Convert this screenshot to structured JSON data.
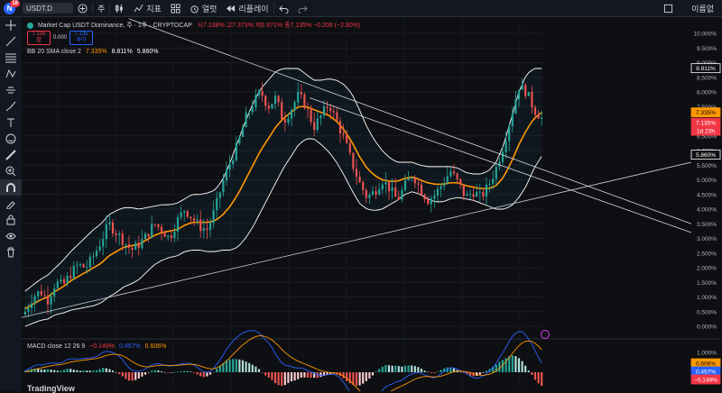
{
  "topbar": {
    "avatar_letter": "N",
    "avatar_badge": "18",
    "symbol": "USDT.D",
    "interval": "주",
    "indicators_label": "지표",
    "alert_label": "얼럿",
    "replay_label": "리플레이",
    "window_label": "이름없"
  },
  "header": {
    "title": "Market Cap USDT Dominance, 주 · 1주 · CRYPTOCAP",
    "ohlc_line": "시7.138% 고7.373% 저6.971% 종7.135% −0.206 (−2.80%)",
    "sell_price": "7.135",
    "sell_label": "팔",
    "spread": "0.000",
    "buy_price": "7.135",
    "buy_label": "바이",
    "bb_label": "BB 20 SMA close 2",
    "bb_basis": "7.335%",
    "bb_upper": "8.811%",
    "bb_lower": "5.860%"
  },
  "macd": {
    "label": "MACD close 12 26 9",
    "macd": "−0.149%",
    "signal": "0.457%",
    "hist": "0.606%"
  },
  "price_axis": {
    "ticks": [
      "10.000%",
      "9.500%",
      "9.000%",
      "8.500%",
      "8.000%",
      "7.500%",
      "6.500%",
      "6.000%",
      "5.500%",
      "5.000%",
      "4.500%",
      "4.000%",
      "3.500%",
      "3.000%",
      "2.500%",
      "2.000%",
      "1.500%",
      "1.000%",
      "0.500%",
      "0.000%"
    ],
    "tag_upper": "8.811%",
    "tag_basis": "7.335%",
    "tag_close": "7.135%",
    "tag_countdown": "1d 23h",
    "tag_lower": "5.860%"
  },
  "macd_axis": {
    "ticks": [
      "1.000%",
      "0.500%",
      "−0.500%"
    ],
    "tag_hist": "0.606%",
    "tag_signal": "0.457%",
    "tag_macd": "−0.149%"
  },
  "watermark": "TradingView",
  "colors": {
    "up": "#26a69a",
    "down": "#ef5350",
    "basis": "#ff9800",
    "band": "#ffffff",
    "signal": "#2962ff"
  },
  "chart_data": {
    "type": "candlestick",
    "title": "Market Cap USDT Dominance",
    "interval": "1W",
    "ylim": [
      0,
      10
    ],
    "close_path": [
      0.5,
      1.0,
      1.2,
      0.9,
      1.5,
      1.4,
      1.8,
      2.1,
      2.0,
      2.4,
      2.9,
      3.5,
      3.2,
      2.9,
      2.6,
      2.8,
      3.1,
      3.5,
      3.3,
      3.0,
      3.6,
      4.0,
      3.7,
      3.4,
      3.3,
      4.0,
      4.9,
      5.6,
      6.2,
      7.1,
      7.6,
      8.0,
      7.5,
      7.8,
      7.0,
      7.4,
      7.9,
      7.5,
      6.8,
      7.2,
      7.6,
      7.0,
      6.4,
      5.6,
      4.9,
      4.4,
      4.6,
      5.0,
      4.7,
      4.3,
      4.8,
      5.2,
      4.7,
      4.3,
      4.5,
      4.9,
      5.3,
      4.9,
      4.4,
      4.6,
      4.4,
      4.8,
      5.4,
      6.2,
      7.2,
      8.2,
      8.0,
      7.4,
      7.1
    ],
    "bb_basis_path": [
      0.6,
      0.75,
      0.9,
      1.0,
      1.2,
      1.35,
      1.55,
      1.7,
      1.85,
      2.0,
      2.15,
      2.4,
      2.55,
      2.7,
      2.75,
      2.8,
      2.95,
      3.1,
      3.2,
      3.25,
      3.3,
      3.45,
      3.55,
      3.55,
      3.55,
      3.6,
      3.8,
      4.1,
      4.5,
      5.0,
      5.5,
      6.0,
      6.4,
      6.8,
      7.1,
      7.3,
      7.5,
      7.5,
      7.4,
      7.3,
      7.2,
      7.0,
      6.7,
      6.3,
      5.8,
      5.4,
      5.15,
      5.0,
      4.95,
      4.95,
      5.05,
      5.1,
      5.0,
      4.9,
      4.85,
      4.85,
      4.9,
      4.9,
      4.8,
      4.75,
      4.7,
      4.7,
      4.8,
      5.1,
      5.6,
      6.2,
      6.7,
      7.1,
      7.3
    ],
    "bb_band_half_width": [
      0.6,
      0.65,
      0.7,
      0.75,
      0.8,
      0.9,
      1.0,
      1.1,
      1.2,
      1.3,
      1.35,
      1.4,
      1.4,
      1.35,
      1.3,
      1.2,
      1.1,
      1.0,
      0.95,
      0.9,
      0.9,
      0.9,
      0.95,
      0.95,
      1.0,
      1.05,
      1.2,
      1.5,
      1.8,
      2.0,
      2.1,
      2.1,
      2.0,
      1.9,
      1.7,
      1.5,
      1.3,
      1.1,
      1.0,
      1.1,
      1.25,
      1.4,
      1.55,
      1.65,
      1.6,
      1.4,
      1.2,
      1.0,
      0.8,
      0.65,
      0.55,
      0.5,
      0.5,
      0.55,
      0.6,
      0.6,
      0.55,
      0.5,
      0.45,
      0.45,
      0.5,
      0.6,
      0.8,
      1.1,
      1.5,
      1.8,
      1.9,
      1.7,
      1.5
    ],
    "trendlines": [
      {
        "name": "support",
        "from": [
          0,
          0.3
        ],
        "to": [
          1,
          5.6
        ]
      },
      {
        "name": "resistance_1",
        "from": [
          0.16,
          10.5
        ],
        "to": [
          1,
          3.5
        ]
      },
      {
        "name": "resistance_2",
        "from": [
          0.43,
          7.8
        ],
        "to": [
          1,
          3.2
        ]
      }
    ],
    "bb": {
      "basis": 7.335,
      "upper": 8.811,
      "lower": 5.86
    },
    "last_close": 7.135,
    "macd": {
      "macd": -0.149,
      "signal": 0.457,
      "hist": 0.606
    }
  }
}
